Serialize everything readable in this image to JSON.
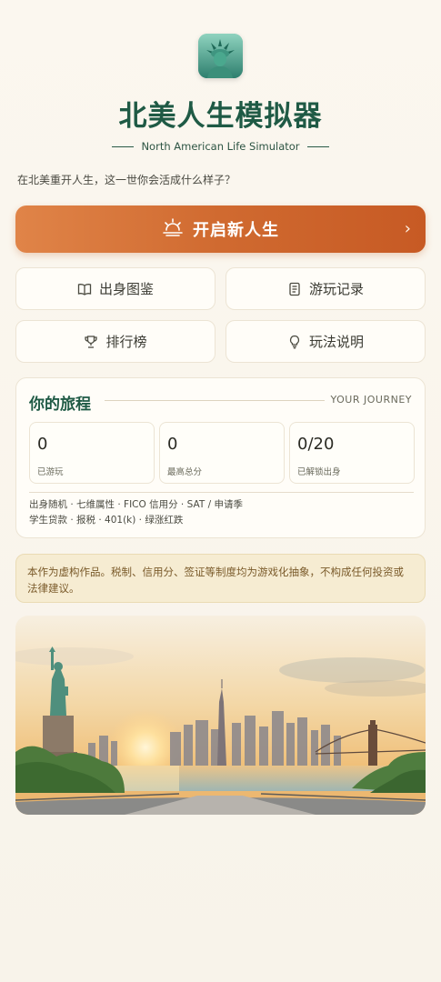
{
  "app": {
    "title": "北美人生模拟器",
    "subtitle": "North American Life Simulator",
    "tagline": "在北美重开人生，这一世你会活成什么样子？",
    "icon": "statue-of-liberty-icon"
  },
  "start_button": {
    "label": "开启新人生",
    "icon": "sunrise-icon",
    "chevron_icon": "chevron-right-icon"
  },
  "menu": {
    "items": [
      {
        "label": "出身图鉴",
        "icon": "book-icon"
      },
      {
        "label": "游玩记录",
        "icon": "notes-icon"
      },
      {
        "label": "排行榜",
        "icon": "trophy-icon"
      },
      {
        "label": "玩法说明",
        "icon": "lightbulb-icon"
      }
    ]
  },
  "journey": {
    "title": "你的旅程",
    "title_en": "YOUR JOURNEY",
    "stats": [
      {
        "value": "0",
        "label": "已游玩"
      },
      {
        "value": "0",
        "label": "最高总分"
      },
      {
        "value": "0/20",
        "label": "已解锁出身"
      }
    ],
    "features_line1": "出身随机 · 七维属性 · FICO 信用分 · SAT / 申请季",
    "features_line2": "学生贷款 · 报税 · 401(k) · 绿涨红跌"
  },
  "disclaimer": "本作为虚构作品。税制、信用分、签证等制度均为游戏化抽象，不构成任何投资或法律建议。",
  "colors": {
    "accent": "#d06a30",
    "brand_green": "#1f5a45",
    "background": "#faf6ee",
    "card": "#fffdf8",
    "disclaimer_bg": "#f6ecd2"
  }
}
